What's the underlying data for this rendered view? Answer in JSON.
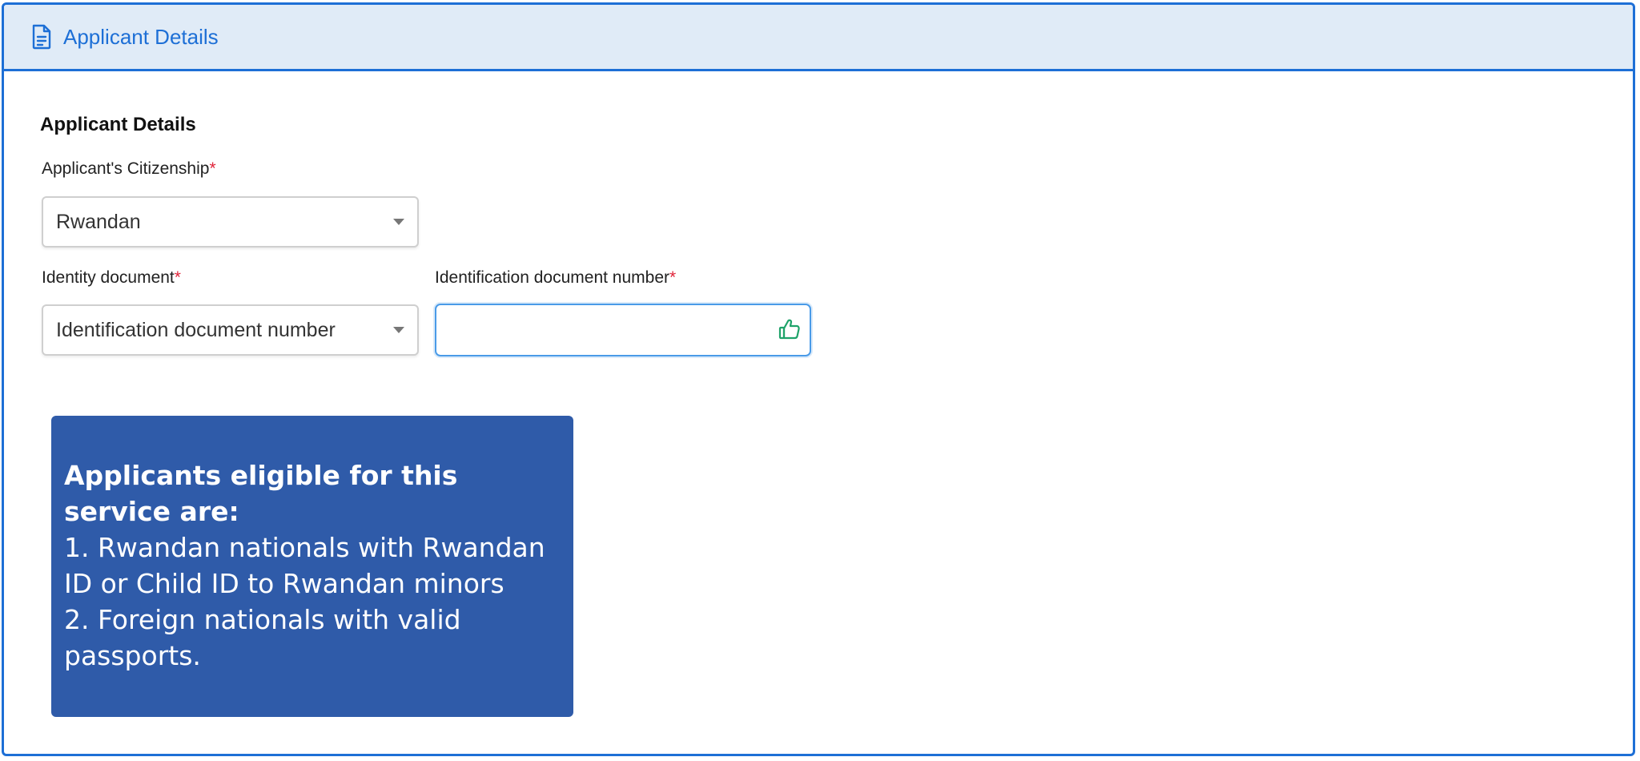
{
  "header": {
    "title": "Applicant Details",
    "icon": "document-icon",
    "accent_color": "#1d6fd6"
  },
  "section": {
    "title": "Applicant Details"
  },
  "fields": {
    "citizenship": {
      "label": "Applicant's Citizenship",
      "required_mark": "*",
      "value": "Rwandan"
    },
    "identity_document": {
      "label": "Identity document",
      "required_mark": "*",
      "value": "Identification document number"
    },
    "id_number": {
      "label": "Identification document number",
      "required_mark": "*",
      "value": "",
      "status_icon": "thumbs-up-icon"
    }
  },
  "tooltip": {
    "heading": "Applicants eligible for this service are:",
    "lines": [
      "1. Rwandan nationals with Rwandan ID or Child ID to Rwandan minors",
      "2. Foreign nationals with valid passports."
    ],
    "background_color": "#2f5ba9"
  }
}
